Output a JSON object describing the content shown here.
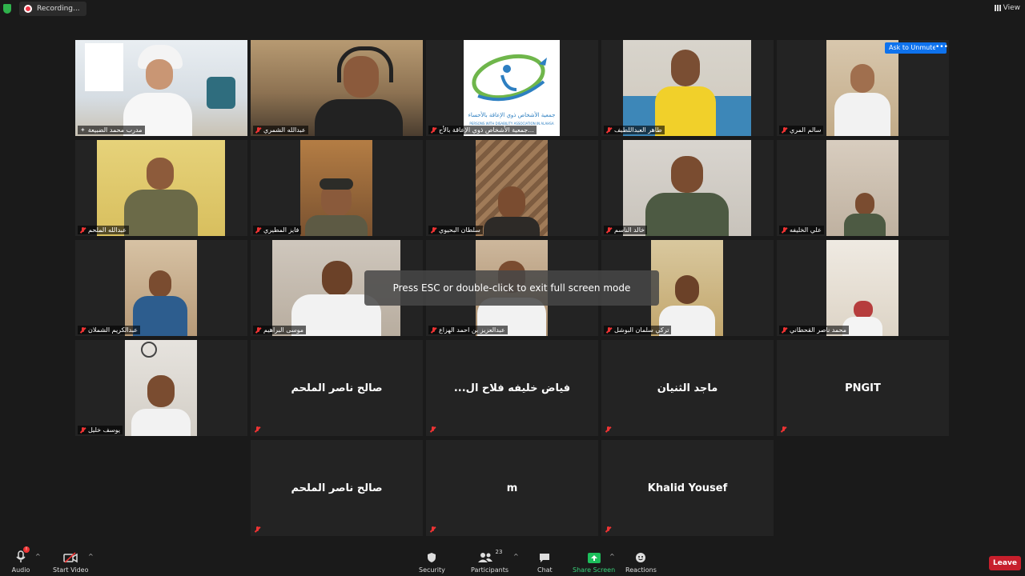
{
  "topbar": {
    "recording_label": "Recording...",
    "view_label": "View"
  },
  "tiles": [
    {
      "name": "مدرب محمد الضبيعة",
      "pinned": true
    },
    {
      "name": "عبدالله الشمري"
    },
    {
      "name": "جمعية الأشخاص ذوي الإعاقة بالأح..."
    },
    {
      "name": "طاهر العبداللطيف"
    },
    {
      "name": "سالم المري"
    },
    {
      "name": "عبدالله الملحم"
    },
    {
      "name": "فايز المطيري"
    },
    {
      "name": "سلطان البحيوي"
    },
    {
      "name": "خالد الناسم"
    },
    {
      "name": "علي الخليفه"
    },
    {
      "name": "عبدالكريم الشملان"
    },
    {
      "name": "موسى البراهيم"
    },
    {
      "name": "عبدالعزيز بن احمد الهزاع"
    },
    {
      "name": "تركي سلمان البوشل"
    },
    {
      "name": "محمد ناصر القحطاني"
    },
    {
      "name": "يوسف خليل"
    },
    {
      "center": "صالح ناصر الملحم"
    },
    {
      "center": "...فياض خليفه فلاح ال"
    },
    {
      "center": "ماجد الثنيان"
    },
    {
      "center": "PNGIT"
    },
    {
      "center": "صالح ناصر الملحم"
    },
    {
      "center": "m"
    },
    {
      "center": "Khalid Yousef"
    }
  ],
  "overlay": {
    "toast": "Press ESC or double-click to exit full screen mode",
    "ask_unmute": "Ask to Unmute",
    "more": "•••"
  },
  "org_logo": {
    "line1": "جمعية الأشخاص ذوي الإعاقة بالأحساء",
    "line2": "PERSONS WITH DISABILITY ASSOCIATION IN ALAHSA"
  },
  "toolbar": {
    "audio": "Audio",
    "audio_badge": "!",
    "start_video": "Start Video",
    "security": "Security",
    "participants": "Participants",
    "participants_count": "23",
    "chat": "Chat",
    "share_screen": "Share Screen",
    "reactions": "Reactions",
    "leave": "Leave"
  },
  "colors": {
    "accent": "#0e72ed",
    "active_border": "#e9e64a",
    "leave": "#c71f2c",
    "share": "#1dbf5c",
    "muted": "#e33"
  }
}
